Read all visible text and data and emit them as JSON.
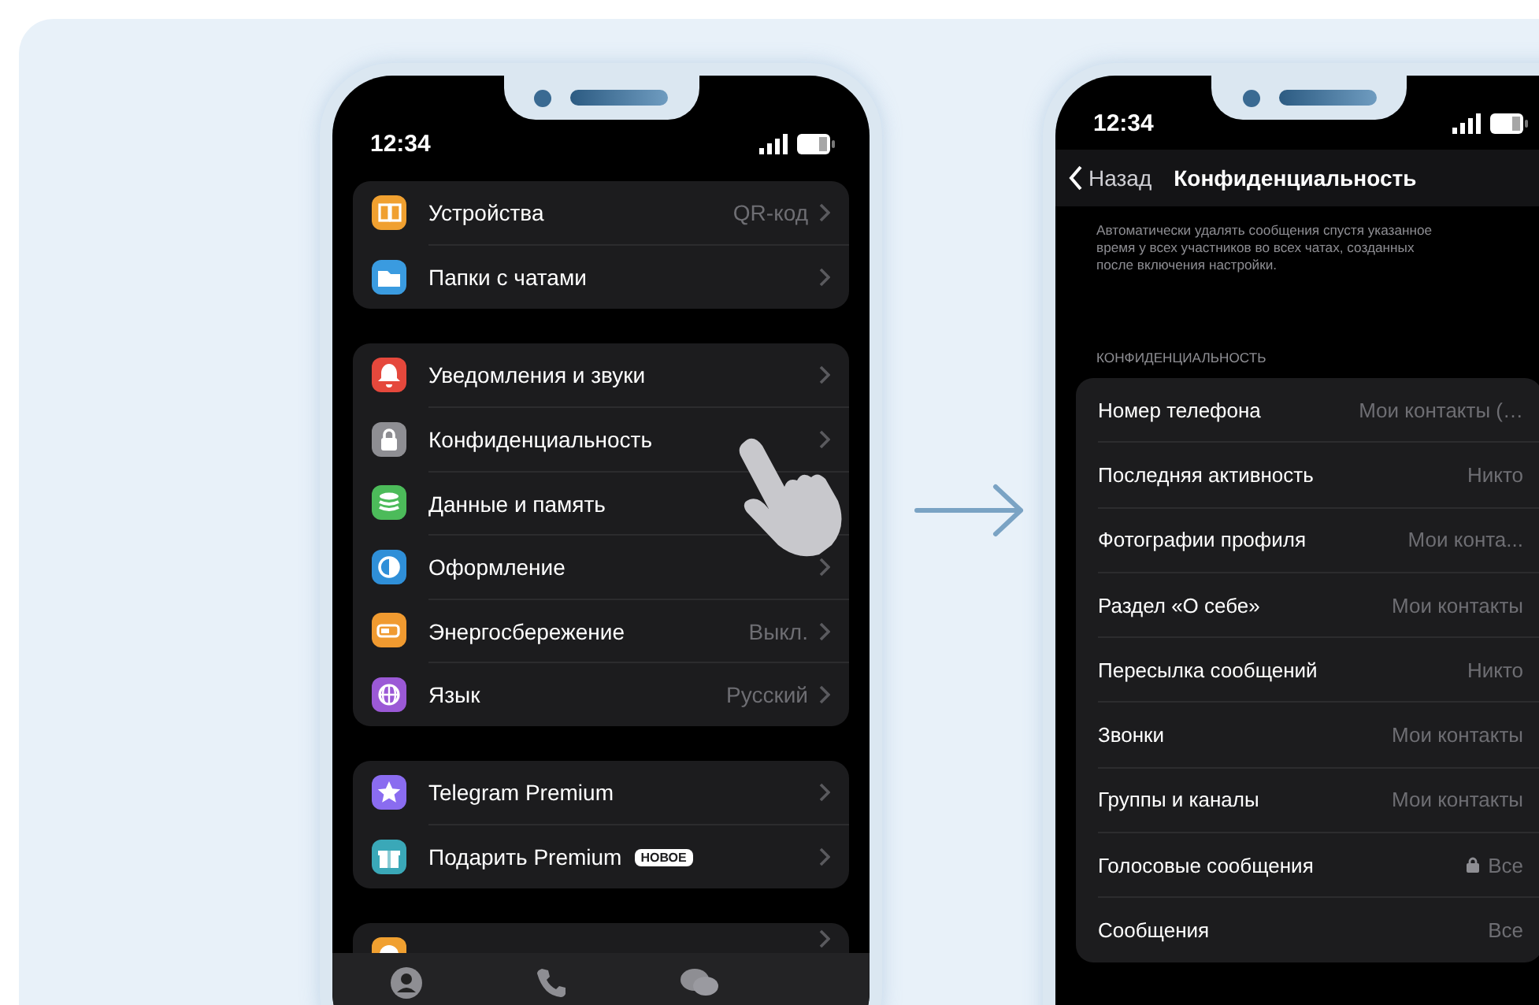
{
  "left_phone": {
    "status_bar": {
      "time": "12:34"
    },
    "groups": [
      {
        "rows": [
          {
            "label": "Устройства",
            "value": "QR-код",
            "color": "#f0a030",
            "kind": "devices"
          },
          {
            "label": "Папки с чатами",
            "color": "#3a9be0",
            "kind": "folder"
          }
        ]
      },
      {
        "rows": [
          {
            "label": "Уведомления и звуки",
            "color": "#e5483c",
            "kind": "bell"
          },
          {
            "label": "Конфиденциальность",
            "color": "#8e8e93",
            "kind": "lock"
          },
          {
            "label": "Данные и память",
            "color": "#4cbb5a",
            "kind": "data"
          },
          {
            "label": "Оформление",
            "color": "#2f8fd8",
            "kind": "theme"
          },
          {
            "label": "Энергосбережение",
            "value": "Выкл.",
            "color": "#f09a30",
            "kind": "battery"
          },
          {
            "label": "Язык",
            "value": "Русский",
            "color": "#9b59d6",
            "kind": "globe"
          }
        ]
      },
      {
        "rows": [
          {
            "label": "Telegram Premium",
            "color": "#8a6cf0",
            "kind": "star"
          },
          {
            "label": "Подарить Premium",
            "badge": "НОВОЕ",
            "color": "#3aa8b8",
            "kind": "gift"
          }
        ]
      },
      {
        "rows": [
          {
            "color": "#f0a030",
            "kind": "help"
          }
        ]
      }
    ],
    "tab_bar": [
      {
        "kind": "contacts"
      },
      {
        "kind": "calls"
      },
      {
        "kind": "chats"
      }
    ]
  },
  "right_phone": {
    "status_bar": {
      "time": "12:34"
    },
    "nav": {
      "back": "Назад",
      "title": "Конфиденциальность"
    },
    "note": "Автоматически удалять сообщения спустя указанное время у всех участников во всех чатах, созданных после включения настройки.",
    "section_header": "КОНФИДЕНЦИАЛЬНОСТЬ",
    "rows": [
      {
        "label": "Номер телефона",
        "value": "Мои контакты (…",
        "locked": false
      },
      {
        "label": "Последняя активность",
        "value": "Никто",
        "locked": false
      },
      {
        "label": "Фотографии профиля",
        "value": "Мои конта...",
        "locked": false
      },
      {
        "label": "Раздел «О себе»",
        "value": "Мои контакты",
        "locked": false
      },
      {
        "label": "Пересылка сообщений",
        "value": "Никто",
        "locked": false
      },
      {
        "label": "Звонки",
        "value": "Мои контакты",
        "locked": false
      },
      {
        "label": "Группы и каналы",
        "value": "Мои контакты",
        "locked": false
      },
      {
        "label": "Голосовые сообщения",
        "value": "Все",
        "locked": true
      },
      {
        "label": "Сообщения",
        "value": "Все",
        "locked": false
      }
    ]
  }
}
